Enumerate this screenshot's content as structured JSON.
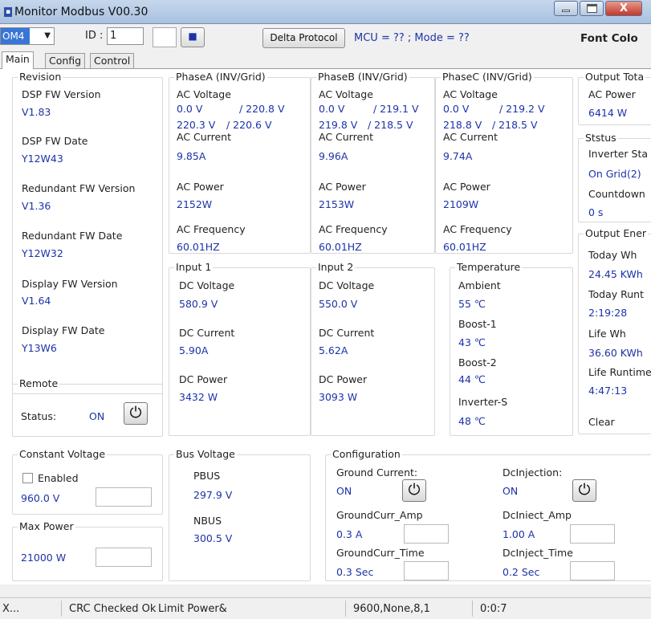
{
  "window": {
    "title": "Monitor Modbus V00.30",
    "close_label": "X"
  },
  "toolbar": {
    "port_value": "OM4",
    "id_label": "ID :",
    "id_value": "1",
    "stop_icon": "■",
    "delta_button": "Delta Protocol",
    "mcu_mode_text": "MCU = ?? ; Mode = ??",
    "font_color_label": "Font Colo"
  },
  "tabs": [
    "Main",
    "Config",
    "Control"
  ],
  "revision": {
    "legend": "Revision",
    "items": [
      {
        "label": "DSP FW Version",
        "value": "V1.83"
      },
      {
        "label": "DSP FW Date",
        "value": "Y12W43"
      },
      {
        "label": "Redundant FW Version",
        "value": "V1.36"
      },
      {
        "label": "Redundant FW Date",
        "value": "Y12W32"
      },
      {
        "label": "Display FW Version",
        "value": "V1.64"
      },
      {
        "label": "Display FW Date",
        "value": "Y13W6"
      }
    ]
  },
  "phases": [
    {
      "legend": "PhaseA (INV/Grid)",
      "voltage_label": "AC Voltage",
      "v1a": "0.0 V",
      "v1b": "/ 220.8 V",
      "v2a": "220.3 V",
      "v2b": "/ 220.6 V",
      "current_label": "AC Current",
      "current": "9.85A",
      "power_label": "AC Power",
      "power": "2152W",
      "freq_label": "AC Frequency",
      "freq": "60.01HZ"
    },
    {
      "legend": "PhaseB (INV/Grid)",
      "voltage_label": "AC Voltage",
      "v1a": "0.0 V",
      "v1b": "/ 219.1 V",
      "v2a": "219.8 V",
      "v2b": "/ 218.5 V",
      "current_label": "AC Current",
      "current": "9.96A",
      "power_label": "AC Power",
      "power": "2153W",
      "freq_label": "AC Frequency",
      "freq": "60.01HZ"
    },
    {
      "legend": "PhaseC (INV/Grid)",
      "voltage_label": "AC Voltage",
      "v1a": "0.0 V",
      "v1b": "/ 219.2 V",
      "v2a": "218.8 V",
      "v2b": "/ 218.5 V",
      "current_label": "AC Current",
      "current": "9.74A",
      "power_label": "AC Power",
      "power": "2109W",
      "freq_label": "AC Frequency",
      "freq": "60.01HZ"
    }
  ],
  "output_total": {
    "legend": "Output Tota",
    "power_label": "AC Power",
    "power": "6414 W"
  },
  "status_group": {
    "legend": "Ststus",
    "state_label": "Inverter Sta",
    "state": "On Grid(2)",
    "countdown_label": "Countdown",
    "countdown": "0 s"
  },
  "output_energy": {
    "legend": "Output Ener",
    "today_wh_label": "Today Wh",
    "today_wh": "24.45 KWh",
    "today_runtime_label": "Today Runt",
    "today_runtime": "2:19:28",
    "life_wh_label": "Life Wh",
    "life_wh": "36.60 KWh",
    "life_runtime_label": "Life Runtime",
    "life_runtime": "4:47:13",
    "clear_label": "Clear"
  },
  "inputs": [
    {
      "legend": "Input 1",
      "voltage_label": "DC Voltage",
      "voltage": "580.9 V",
      "current_label": "DC Current",
      "current": "5.90A",
      "power_label": "DC Power",
      "power": "3432 W"
    },
    {
      "legend": "Input 2",
      "voltage_label": "DC Voltage",
      "voltage": "550.0 V",
      "current_label": "DC Current",
      "current": "5.62A",
      "power_label": "DC Power",
      "power": "3093 W"
    }
  ],
  "temperature": {
    "legend": "Temperature",
    "items": [
      {
        "label": "Ambient",
        "value": "55 ℃"
      },
      {
        "label": "Boost-1",
        "value": "43 ℃"
      },
      {
        "label": "Boost-2",
        "value": "44 ℃"
      },
      {
        "label": "Inverter-S",
        "value": "48 ℃"
      }
    ]
  },
  "remote": {
    "legend": "Remote",
    "status_label": "Status:",
    "status_value": "ON"
  },
  "constant_voltage": {
    "legend": "Constant Voltage",
    "enabled_label": "Enabled",
    "value": "960.0 V"
  },
  "max_power": {
    "legend": "Max Power",
    "value": "21000 W"
  },
  "bus_voltage": {
    "legend": "Bus Voltage",
    "pbus_label": "PBUS",
    "pbus": "297.9 V",
    "nbus_label": "NBUS",
    "nbus": "300.5 V"
  },
  "configuration": {
    "legend": "Configuration",
    "ground_current_label": "Ground Current:",
    "ground_current": "ON",
    "dc_injection_label": "DcInjection:",
    "dc_injection": "ON",
    "groundcurr_amp_label": "GroundCurr_Amp",
    "groundcurr_amp": "0.3 A",
    "dcinject_amp_label": "DcIniect_Amp",
    "dcinject_amp": "1.00 A",
    "groundcurr_time_label": "GroundCurr_Time",
    "groundcurr_time": "0.3 Sec",
    "dcinject_time_label": "DcInject_Time",
    "dcinject_time": "0.2 Sec"
  },
  "power_icon": "⏻",
  "statusbar": {
    "port": "X...",
    "crc": "CRC Checked Ok",
    "limit": "Limit Power&",
    "serial": "9600,None,8,1",
    "time": "0:0:7"
  }
}
